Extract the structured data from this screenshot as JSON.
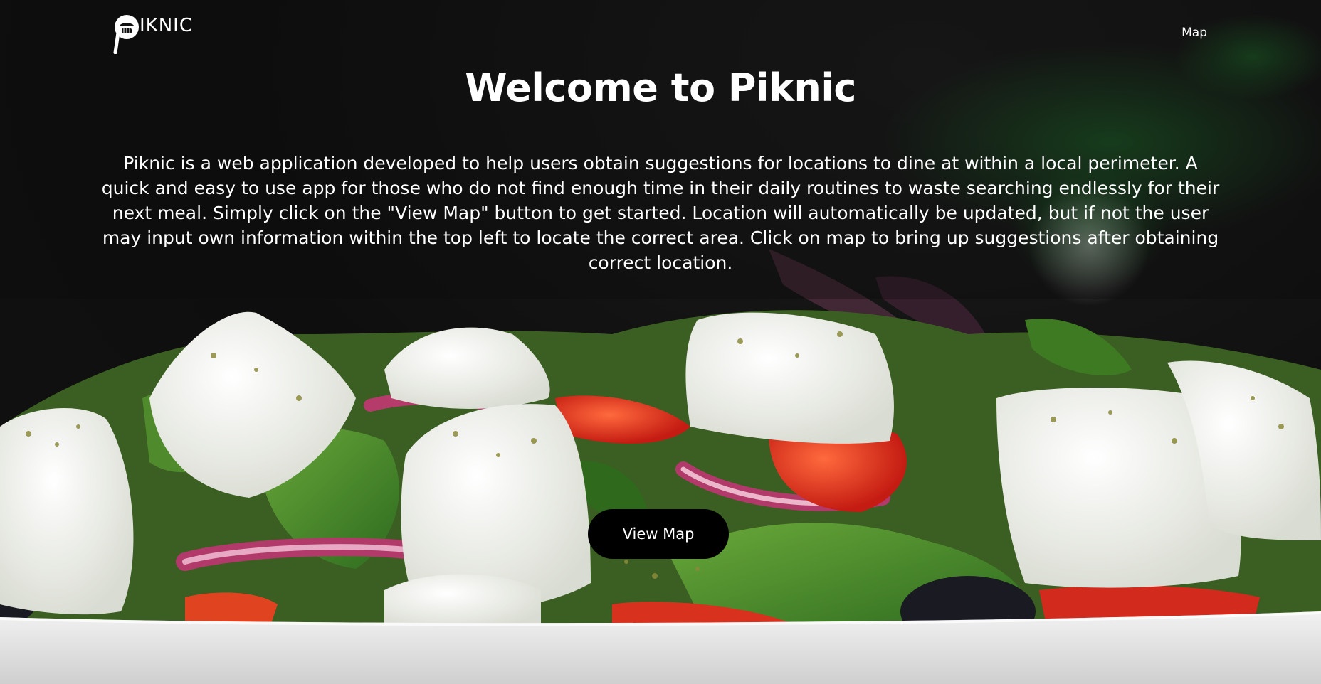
{
  "brand": {
    "name": "IKNIC"
  },
  "nav": {
    "map_label": "Map"
  },
  "hero": {
    "title": "Welcome to Piknic",
    "description": "Piknic is a web application developed to help users obtain suggestions for locations to dine at within a local perimeter. A quick and easy to use app for those who do not find enough time in their daily routines to waste searching endlessly for their next meal. Simply click on the \"View Map\" button to get started. Location will automatically be updated, but if not the user may input own information within the top left to locate the correct area. Click on map to bring up suggestions after obtaining correct location.",
    "cta_label": "View Map",
    "background_image": "greek-salad-feta-photo"
  },
  "colors": {
    "text": "#ffffff",
    "button_bg": "#000000",
    "overlay_dark": "#101010"
  }
}
